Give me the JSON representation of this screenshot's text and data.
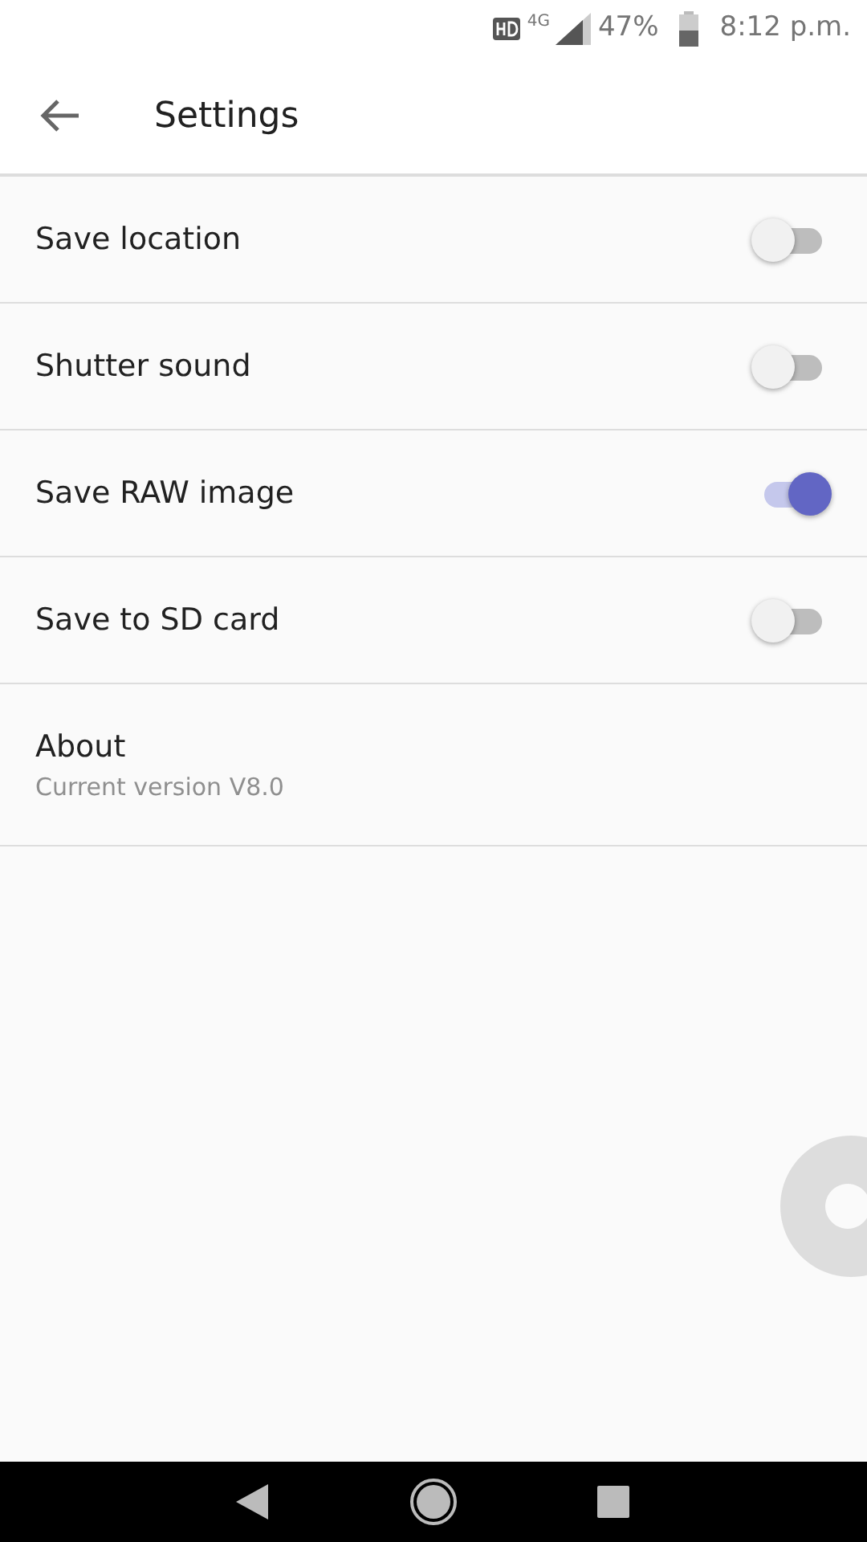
{
  "status_bar": {
    "network": "4G",
    "battery": "47%",
    "time": "8:12 p.m."
  },
  "app_bar": {
    "title": "Settings"
  },
  "settings": [
    {
      "kind": "toggle",
      "label": "Save location",
      "on": false
    },
    {
      "kind": "toggle",
      "label": "Shutter sound",
      "on": false
    },
    {
      "kind": "toggle",
      "label": "Save RAW image",
      "on": true
    },
    {
      "kind": "toggle",
      "label": "Save to SD card",
      "on": false
    },
    {
      "kind": "info",
      "label": "About",
      "subtitle": "Current version V8.0"
    }
  ]
}
